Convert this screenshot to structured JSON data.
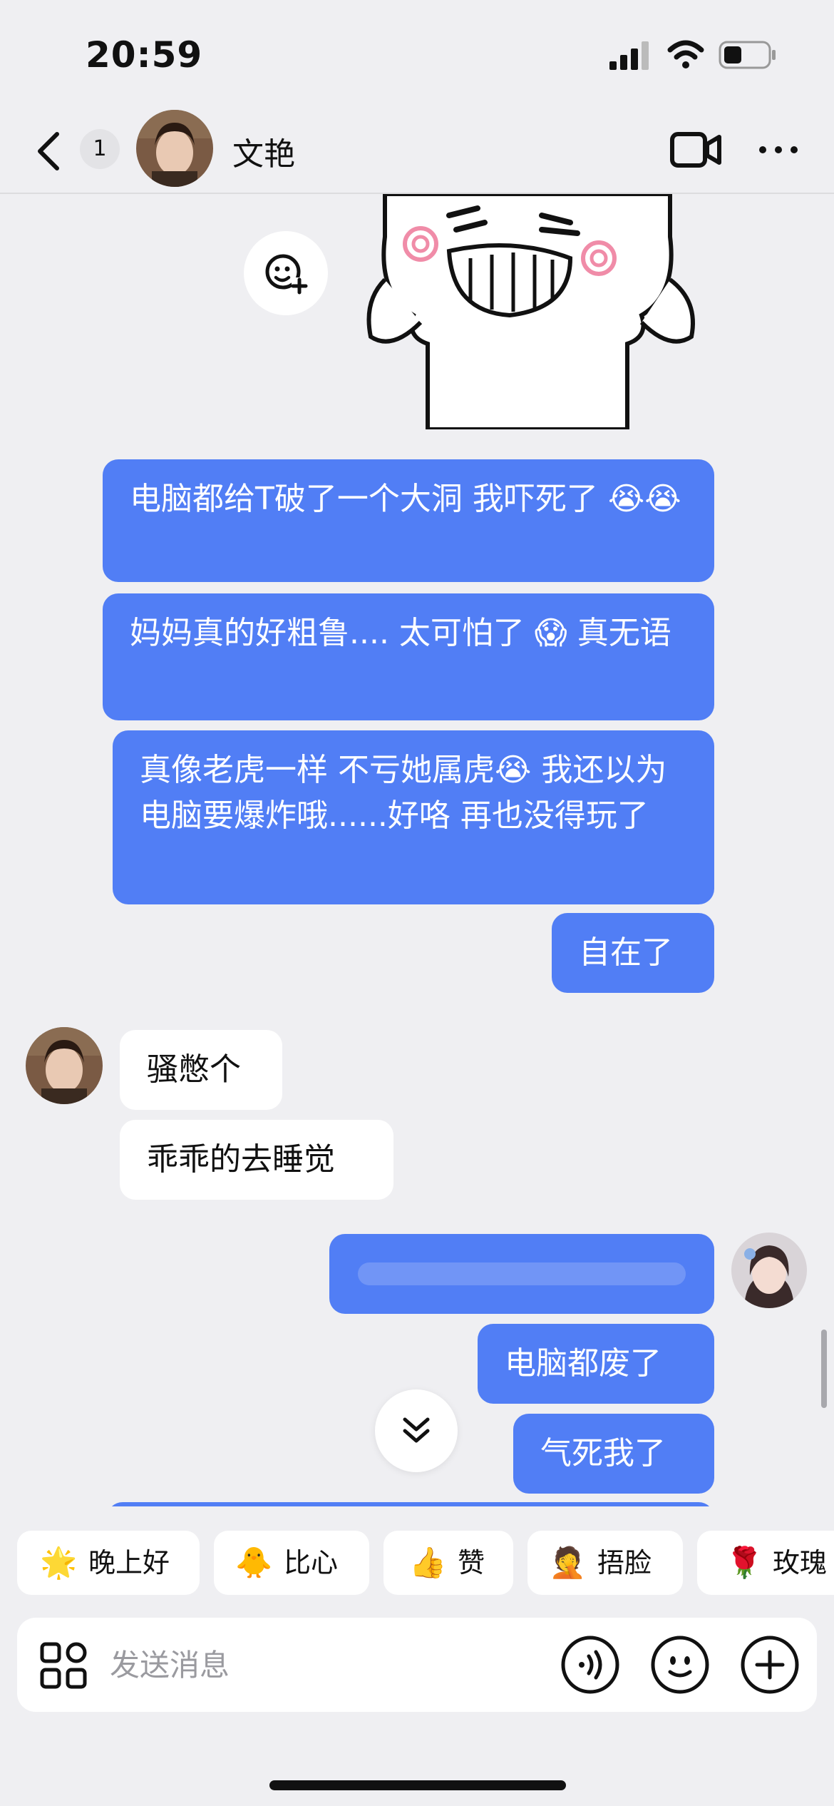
{
  "status_bar": {
    "time": "20:59"
  },
  "header": {
    "unread_count": "1",
    "contact_name": "文艳"
  },
  "messages": {
    "m1": "电脑都给T破了一个大洞 我吓死了",
    "m1_emoji": "😭😭",
    "m2": "妈妈真的好粗鲁.... 太可怕了 😱 真无语",
    "m3": "真像老虎一样 不亏她属虎😭 我还以为电脑要爆炸哦......好咯 再也没得玩了",
    "m4": "自在了",
    "r1": "骚憋个",
    "r2": "乖乖的去睡觉",
    "m6": "电脑都废了",
    "m7": "气死我了"
  },
  "quick_replies": [
    {
      "emoji": "🌟",
      "label": "晚上好"
    },
    {
      "emoji": "🐥",
      "label": "比心"
    },
    {
      "emoji": "👍",
      "label": "赞"
    },
    {
      "emoji": "🤦",
      "label": "捂脸"
    },
    {
      "emoji": "🌹",
      "label": "玫瑰"
    }
  ],
  "input": {
    "placeholder": "发送消息"
  },
  "icons": {
    "back": "chevron-left-icon",
    "video": "video-call-icon",
    "more": "more-dots-icon",
    "sticker_add": "add-sticker-icon",
    "scroll_down": "double-chevron-down-icon",
    "apps": "apps-grid-icon",
    "voice": "voice-icon",
    "emoji": "emoji-face-icon",
    "plus": "plus-circle-icon"
  },
  "colors": {
    "outgoing_bubble": "#517ef5",
    "incoming_bubble": "#ffffff",
    "background": "#efeff2"
  }
}
